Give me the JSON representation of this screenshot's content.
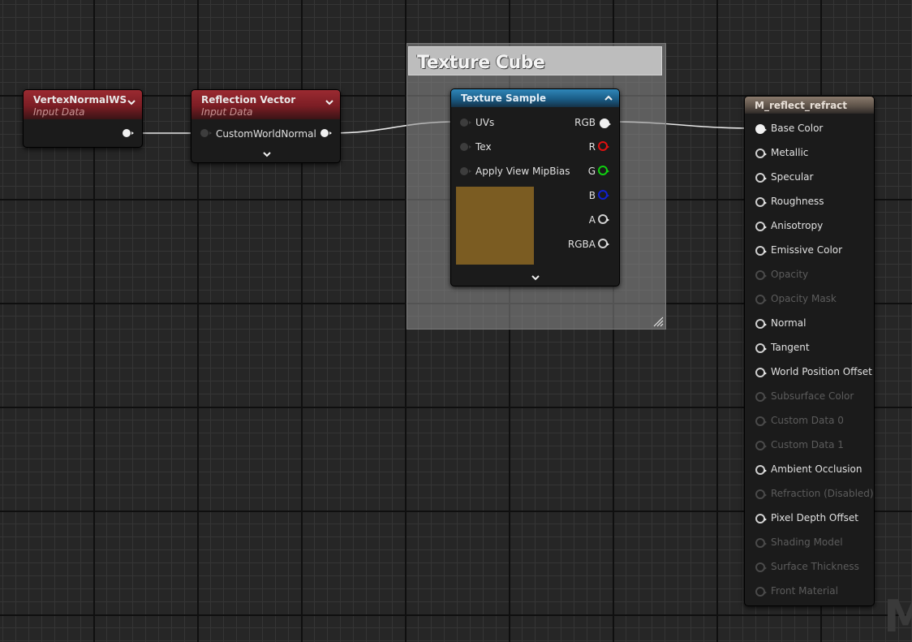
{
  "nodes": {
    "vertex_normal": {
      "title": "VertexNormalWS",
      "subtitle": "Input Data"
    },
    "reflection_vector": {
      "title": "Reflection Vector",
      "subtitle": "Input Data",
      "input_label": "CustomWorldNormal"
    },
    "comment": {
      "title": "Texture Cube"
    },
    "texture_sample": {
      "title": "Texture Sample",
      "inputs": [
        "UVs",
        "Tex",
        "Apply View MipBias"
      ],
      "outputs": [
        "RGB",
        "R",
        "G",
        "B",
        "A",
        "RGBA"
      ],
      "preview_color": "#7b5c22"
    },
    "material": {
      "title": "M_reflect_refract",
      "pins": [
        {
          "label": "Base Color",
          "enabled": true
        },
        {
          "label": "Metallic",
          "enabled": true
        },
        {
          "label": "Specular",
          "enabled": true
        },
        {
          "label": "Roughness",
          "enabled": true
        },
        {
          "label": "Anisotropy",
          "enabled": true
        },
        {
          "label": "Emissive Color",
          "enabled": true
        },
        {
          "label": "Opacity",
          "enabled": false
        },
        {
          "label": "Opacity Mask",
          "enabled": false
        },
        {
          "label": "Normal",
          "enabled": true
        },
        {
          "label": "Tangent",
          "enabled": true
        },
        {
          "label": "World Position Offset",
          "enabled": true
        },
        {
          "label": "Subsurface Color",
          "enabled": false
        },
        {
          "label": "Custom Data 0",
          "enabled": false
        },
        {
          "label": "Custom Data 1",
          "enabled": false
        },
        {
          "label": "Ambient Occlusion",
          "enabled": true
        },
        {
          "label": "Refraction (Disabled)",
          "enabled": false
        },
        {
          "label": "Pixel Depth Offset",
          "enabled": true
        },
        {
          "label": "Shading Model",
          "enabled": false
        },
        {
          "label": "Surface Thickness",
          "enabled": false
        },
        {
          "label": "Front Material",
          "enabled": false
        }
      ]
    }
  },
  "watermark": "M",
  "colors": {
    "input_header": "#8f2630",
    "texture_header": "#2a78a6",
    "result_header": "#7a6b5e",
    "pin_r": "#e01010",
    "pin_g": "#10d010",
    "pin_b": "#1020d0"
  }
}
